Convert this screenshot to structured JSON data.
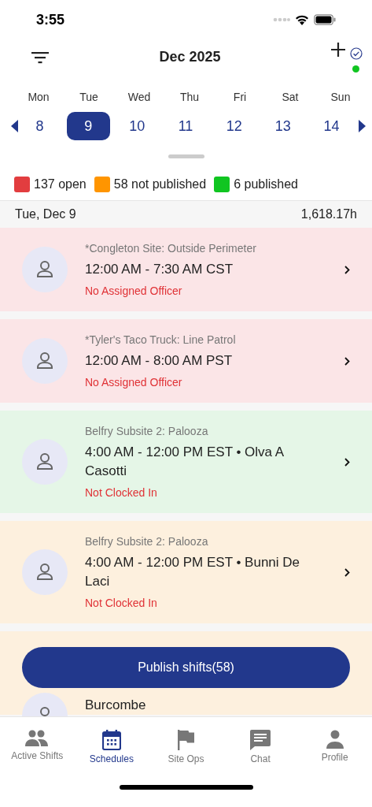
{
  "status_bar": {
    "time": "3:55"
  },
  "header": {
    "title": "Dec 2025",
    "online": true
  },
  "week": {
    "days": [
      {
        "weekday": "Mon",
        "date": "8",
        "selected": false
      },
      {
        "weekday": "Tue",
        "date": "9",
        "selected": true
      },
      {
        "weekday": "Wed",
        "date": "10",
        "selected": false
      },
      {
        "weekday": "Thu",
        "date": "11",
        "selected": false
      },
      {
        "weekday": "Fri",
        "date": "12",
        "selected": false
      },
      {
        "weekday": "Sat",
        "date": "13",
        "selected": false
      },
      {
        "weekday": "Sun",
        "date": "14",
        "selected": false
      }
    ]
  },
  "legend": [
    {
      "label": "137 open",
      "color": "#e23d3f"
    },
    {
      "label": "58 not published",
      "color": "#ff9500"
    },
    {
      "label": "6 published",
      "color": "#10c521"
    }
  ],
  "day_header": {
    "date": "Tue, Dec 9",
    "hours": "1,618.17h"
  },
  "shifts": [
    {
      "kind": "open",
      "site": "*Congleton Site: Outside Perimeter",
      "time": "12:00 AM - 7:30 AM CST",
      "alert": "No Assigned Officer"
    },
    {
      "kind": "open",
      "site": "*Tyler's Taco Truck: Line Patrol",
      "time": "12:00 AM - 8:00 AM PST",
      "alert": "No Assigned Officer"
    },
    {
      "kind": "published",
      "site": "Belfry Subsite 2: Palooza",
      "time": "4:00 AM - 12:00 PM EST • Olva A Casotti",
      "alert": "Not Clocked In"
    },
    {
      "kind": "not_published",
      "site": "Belfry Subsite 2: Palooza",
      "time": "4:00 AM - 12:00 PM EST • Bunni De Laci",
      "alert": "Not Clocked In"
    },
    {
      "kind": "not_published",
      "time": "Burcombe"
    }
  ],
  "publish_button": "Publish shifts(58)",
  "tabs": [
    {
      "label": "Active Shifts",
      "kind": "people",
      "selected": false
    },
    {
      "label": "Schedules",
      "kind": "calendar",
      "selected": true
    },
    {
      "label": "Site Ops",
      "kind": "flag",
      "selected": false
    },
    {
      "label": "Chat",
      "kind": "chat",
      "selected": false
    },
    {
      "label": "Profile",
      "kind": "person",
      "selected": false
    }
  ]
}
